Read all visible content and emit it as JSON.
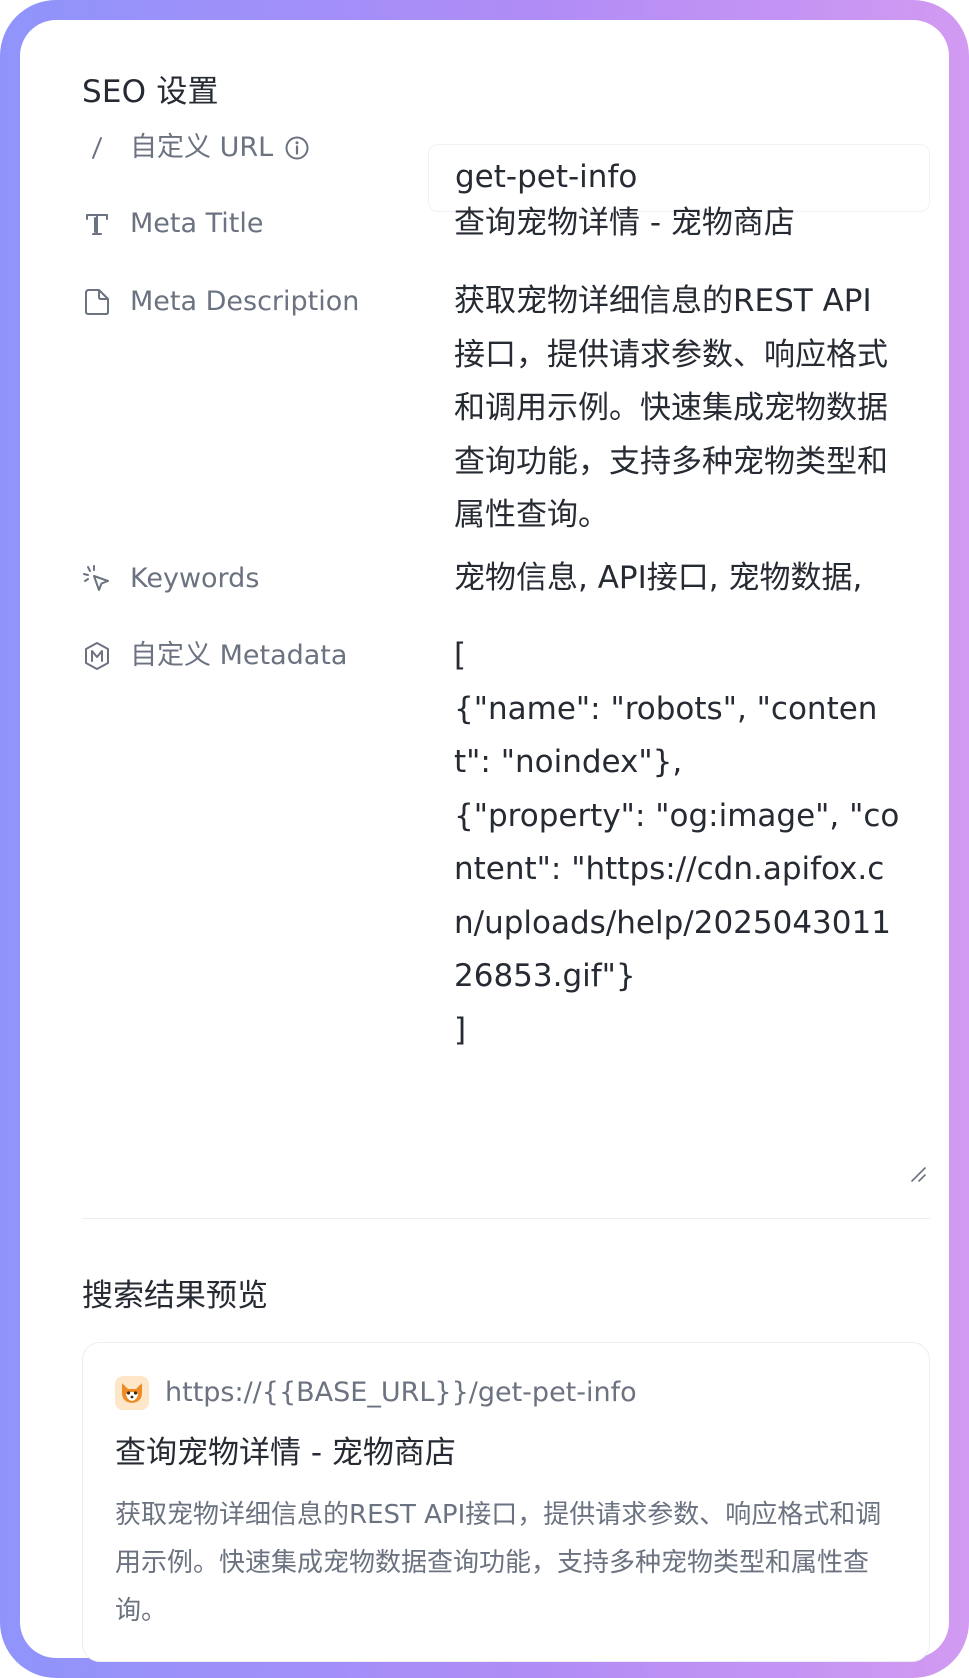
{
  "seo": {
    "section_title": "SEO 设置",
    "fields": {
      "custom_url": {
        "label": "自定义 URL",
        "value": "get-pet-info",
        "icon": "slash-icon",
        "help_icon": "info-icon"
      },
      "meta_title": {
        "label": "Meta Title",
        "value": "查询宠物详情 - 宠物商店",
        "icon": "text-icon"
      },
      "meta_description": {
        "label": "Meta Description",
        "value": "获取宠物详细信息的REST API接口，提供请求参数、响应格式和调用示例。快速集成宠物数据查询功能，支持多种宠物类型和属性查询。",
        "icon": "document-icon"
      },
      "keywords": {
        "label": "Keywords",
        "value": "宠物信息, API接口, 宠物数据,",
        "icon": "cursor-click-icon"
      },
      "custom_metadata": {
        "label": "自定义 Metadata",
        "value": "[\n{\"name\": \"robots\", \"content\": \"noindex\"},\n{\"property\": \"og:image\", \"content\": \"https://cdn.apifox.cn/uploads/help/202504301126853.gif\"}\n]",
        "icon": "m-badge-icon"
      }
    }
  },
  "preview": {
    "section_title": "搜索结果预览",
    "url": "https://{{BASE_URL}}/get-pet-info",
    "title": "查询宠物详情 - 宠物商店",
    "description": "获取宠物详细信息的REST API接口，提供请求参数、响应格式和调用示例。快速集成宠物数据查询功能，支持多种宠物类型和属性查询。",
    "favicon": "fox-icon"
  },
  "colors": {
    "frame_gradient_start": "#8f94fb",
    "frame_gradient_end": "#d29af2",
    "text_primary": "#262a33",
    "text_secondary": "#6b7280"
  }
}
